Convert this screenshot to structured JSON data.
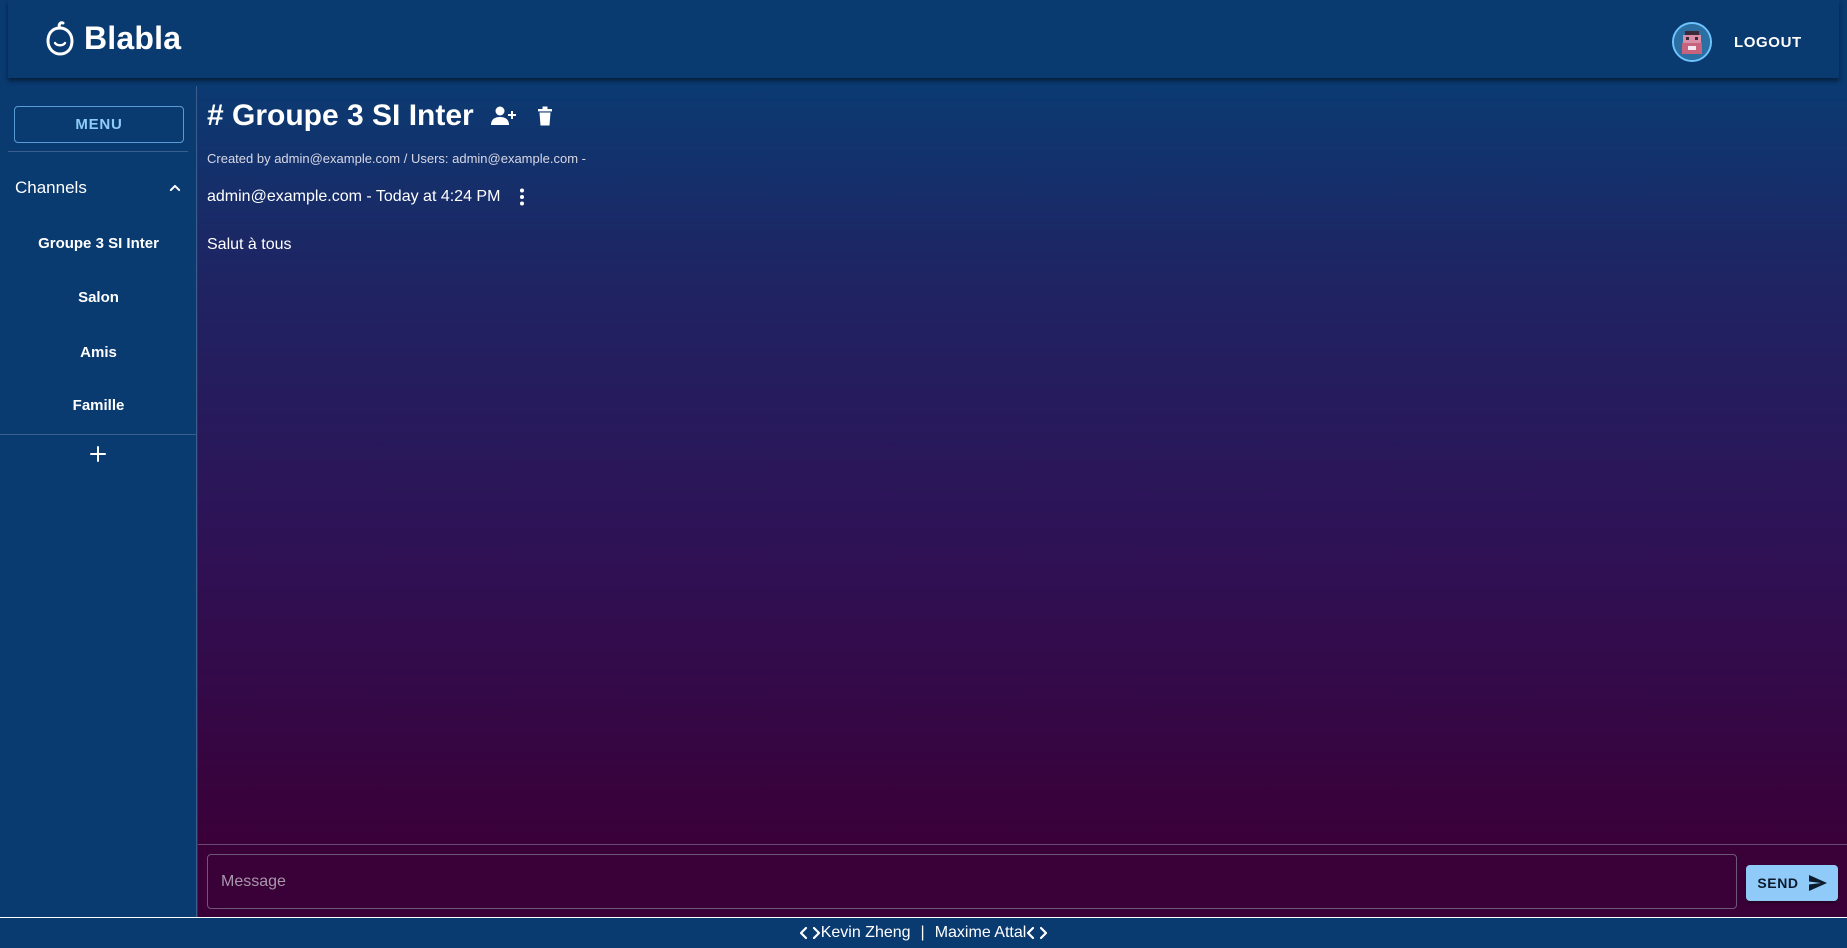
{
  "app": {
    "name": "Blabla",
    "logout_label": "LOGOUT"
  },
  "sidebar": {
    "menu_label": "MENU",
    "channels_label": "Channels",
    "channels": [
      {
        "label": "Groupe 3 SI Inter"
      },
      {
        "label": "Salon"
      },
      {
        "label": "Amis"
      },
      {
        "label": "Famille"
      }
    ]
  },
  "channel": {
    "title": "# Groupe 3 SI Inter",
    "meta": "Created by admin@example.com / Users: admin@example.com -"
  },
  "messages": [
    {
      "header": "admin@example.com - Today at 4:24 PM",
      "text": "Salut à tous"
    }
  ],
  "composer": {
    "placeholder": "Message",
    "send_label": "SEND"
  },
  "footer": {
    "author1": "Kevin Zheng",
    "separator": "|",
    "author2": "Maxime Attal"
  },
  "icons": {
    "logo": "blabla-logo-icon",
    "avatar": "user-avatar",
    "chevron": "chevron-up-icon",
    "add": "plus-icon",
    "add_user": "add-user-icon",
    "delete": "trash-icon",
    "more": "more-vert-icon",
    "send": "send-icon",
    "code": "code-icon"
  },
  "colors": {
    "primary": "#093a70",
    "accent": "#90caf9",
    "gradient_end": "#3a0038"
  }
}
